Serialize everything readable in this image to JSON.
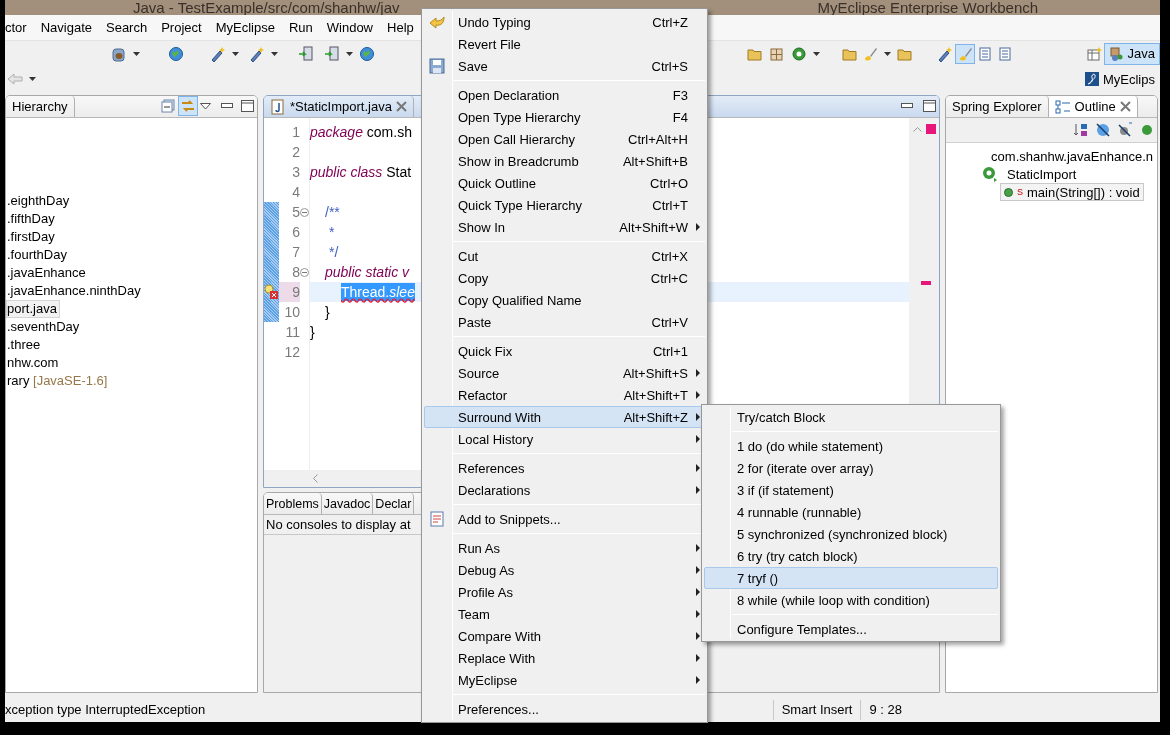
{
  "window": {
    "title_left": "Java - TestExample/src/com/shanhw/jav",
    "title_right": "MyEclipse Enterprise Workbench"
  },
  "menu_bar": [
    "ctor",
    "Navigate",
    "Search",
    "Project",
    "MyEclipse",
    "Run",
    "Window",
    "Help"
  ],
  "perspectives": [
    {
      "label": "Java",
      "selected": true
    },
    {
      "label": "MyEclips",
      "selected": false
    }
  ],
  "left_panel": {
    "tabs": [
      {
        "label": "Hierarchy",
        "selected": false
      }
    ],
    "items": [
      {
        "label": ".eighthDay",
        "selected": false
      },
      {
        "label": ".fifthDay",
        "selected": false
      },
      {
        "label": ".firstDay",
        "selected": false
      },
      {
        "label": ".fourthDay",
        "selected": false
      },
      {
        "label": ".javaEnhance",
        "selected": false
      },
      {
        "label": ".javaEnhance.ninthDay",
        "selected": false
      },
      {
        "label": "port.java",
        "selected": true
      },
      {
        "label": ".seventhDay",
        "selected": false
      },
      {
        "label": ".three",
        "selected": false
      },
      {
        "label": "nhw.com",
        "selected": false
      },
      {
        "label": "rary",
        "suffix": "[JavaSE-1.6]",
        "selected": false
      }
    ]
  },
  "editor": {
    "tab": {
      "label": "*StaticImport.java",
      "selected": true
    },
    "lines": [
      {
        "number": "1",
        "kind": "top",
        "changed": false,
        "current": false,
        "tokens": [
          {
            "text": "package",
            "kind": "keyword"
          },
          {
            "text": "com.sh",
            "kind": "plain"
          }
        ]
      },
      {
        "number": "2",
        "kind": "top",
        "changed": false,
        "current": false
      },
      {
        "number": "3",
        "kind": "top",
        "changed": false,
        "current": false,
        "tokens": [
          {
            "text": "public class",
            "kind": "keyword"
          },
          {
            "text": "Stat",
            "kind": "plain"
          }
        ]
      },
      {
        "number": "4",
        "kind": "top",
        "changed": false,
        "current": false
      },
      {
        "number": "5",
        "kind": "member",
        "collapsible": true,
        "changed": true,
        "current": false,
        "tokens": [
          {
            "text": "/**",
            "kind": "comment"
          }
        ]
      },
      {
        "number": "6",
        "kind": "doc",
        "changed": true,
        "current": false,
        "tokens": [
          {
            "text": "*",
            "kind": "comment"
          }
        ]
      },
      {
        "number": "7",
        "kind": "doc",
        "changed": true,
        "current": false,
        "tokens": [
          {
            "text": "*/",
            "kind": "comment"
          }
        ]
      },
      {
        "number": "8",
        "kind": "member",
        "collapsible": true,
        "changed": true,
        "current": false,
        "tokens": [
          {
            "text": "public static v",
            "kind": "keyword"
          }
        ]
      },
      {
        "number": "9",
        "kind": "body",
        "changed": true,
        "current": true,
        "error": true,
        "tokens": [
          {
            "text": "Thread.",
            "kind": "selected"
          },
          {
            "text": "slee",
            "kind": "selected_static"
          }
        ]
      },
      {
        "number": "10",
        "kind": "member",
        "changed": true,
        "current": false,
        "tokens": [
          {
            "text": "}",
            "kind": "plain"
          }
        ]
      },
      {
        "number": "11",
        "kind": "top",
        "changed": false,
        "current": false,
        "tokens": [
          {
            "text": "}",
            "kind": "plain"
          }
        ]
      },
      {
        "number": "12",
        "kind": "top",
        "changed": false,
        "current": false
      }
    ]
  },
  "console": {
    "tabs": [
      {
        "label": "Problems"
      },
      {
        "label": "Javadoc"
      },
      {
        "label": "Declar"
      }
    ],
    "message": "No consoles to display at"
  },
  "outline": {
    "tabs": [
      {
        "label": "Spring Explorer",
        "selected": false
      },
      {
        "label": "Outline",
        "selected": true
      }
    ],
    "tree": [
      {
        "label": "com.shanhw.javaEnhance.n",
        "kind": "package",
        "selected": false
      },
      {
        "label": "StaticImport",
        "kind": "class",
        "selected": false,
        "children": [
          {
            "label": "main(String[]) : void",
            "kind": "method",
            "badge": "S",
            "selected": true
          }
        ]
      }
    ]
  },
  "context_menu": [
    {
      "kind": "item",
      "label": "Undo Typing",
      "shortcut": "Ctrl+Z",
      "submenu": false,
      "selected": false
    },
    {
      "kind": "item",
      "label": "Revert File",
      "submenu": false,
      "selected": false
    },
    {
      "kind": "item",
      "label": "Save",
      "shortcut": "Ctrl+S",
      "submenu": false,
      "selected": false
    },
    {
      "kind": "separator"
    },
    {
      "kind": "item",
      "label": "Open Declaration",
      "shortcut": "F3",
      "submenu": false,
      "selected": false
    },
    {
      "kind": "item",
      "label": "Open Type Hierarchy",
      "shortcut": "F4",
      "submenu": false,
      "selected": false
    },
    {
      "kind": "item",
      "label": "Open Call Hierarchy",
      "shortcut": "Ctrl+Alt+H",
      "submenu": false,
      "selected": false
    },
    {
      "kind": "item",
      "label": "Show in Breadcrumb",
      "shortcut": "Alt+Shift+B",
      "submenu": false,
      "selected": false
    },
    {
      "kind": "item",
      "label": "Quick Outline",
      "shortcut": "Ctrl+O",
      "submenu": false,
      "selected": false
    },
    {
      "kind": "item",
      "label": "Quick Type Hierarchy",
      "shortcut": "Ctrl+T",
      "submenu": false,
      "selected": false
    },
    {
      "kind": "item",
      "label": "Show In",
      "shortcut": "Alt+Shift+W",
      "submenu": true,
      "selected": false
    },
    {
      "kind": "separator"
    },
    {
      "kind": "item",
      "label": "Cut",
      "shortcut": "Ctrl+X",
      "submenu": false,
      "selected": false
    },
    {
      "kind": "item",
      "label": "Copy",
      "shortcut": "Ctrl+C",
      "submenu": false,
      "selected": false
    },
    {
      "kind": "item",
      "label": "Copy Qualified Name",
      "submenu": false,
      "selected": false
    },
    {
      "kind": "item",
      "label": "Paste",
      "shortcut": "Ctrl+V",
      "submenu": false,
      "selected": false
    },
    {
      "kind": "separator"
    },
    {
      "kind": "item",
      "label": "Quick Fix",
      "shortcut": "Ctrl+1",
      "submenu": false,
      "selected": false
    },
    {
      "kind": "item",
      "label": "Source",
      "shortcut": "Alt+Shift+S",
      "submenu": true,
      "selected": false
    },
    {
      "kind": "item",
      "label": "Refactor",
      "shortcut": "Alt+Shift+T",
      "submenu": true,
      "selected": false
    },
    {
      "kind": "item",
      "label": "Surround With",
      "shortcut": "Alt+Shift+Z",
      "submenu": true,
      "selected": true
    },
    {
      "kind": "item",
      "label": "Local History",
      "submenu": true,
      "selected": false
    },
    {
      "kind": "separator"
    },
    {
      "kind": "item",
      "label": "References",
      "submenu": true,
      "selected": false
    },
    {
      "kind": "item",
      "label": "Declarations",
      "submenu": true,
      "selected": false
    },
    {
      "kind": "separator"
    },
    {
      "kind": "item",
      "label": "Add to Snippets...",
      "submenu": false,
      "selected": false
    },
    {
      "kind": "separator"
    },
    {
      "kind": "item",
      "label": "Run As",
      "submenu": true,
      "selected": false
    },
    {
      "kind": "item",
      "label": "Debug As",
      "submenu": true,
      "selected": false
    },
    {
      "kind": "item",
      "label": "Profile As",
      "submenu": true,
      "selected": false
    },
    {
      "kind": "item",
      "label": "Team",
      "submenu": true,
      "selected": false
    },
    {
      "kind": "item",
      "label": "Compare With",
      "submenu": true,
      "selected": false
    },
    {
      "kind": "item",
      "label": "Replace With",
      "submenu": true,
      "selected": false
    },
    {
      "kind": "item",
      "label": "MyEclipse",
      "submenu": true,
      "selected": false
    },
    {
      "kind": "separator"
    },
    {
      "kind": "item",
      "label": "Preferences...",
      "submenu": false,
      "selected": false
    }
  ],
  "submenu": [
    {
      "kind": "item",
      "label": "Try/catch Block",
      "selected": false
    },
    {
      "kind": "separator"
    },
    {
      "kind": "item",
      "label": "1 do (do while statement)",
      "selected": false
    },
    {
      "kind": "item",
      "label": "2 for (iterate over array)",
      "selected": false
    },
    {
      "kind": "item",
      "label": "3 if (if statement)",
      "selected": false
    },
    {
      "kind": "item",
      "label": "4 runnable (runnable)",
      "selected": false
    },
    {
      "kind": "item",
      "label": "5 synchronized (synchronized block)",
      "selected": false
    },
    {
      "kind": "item",
      "label": "6 try (try catch block)",
      "selected": false
    },
    {
      "kind": "item",
      "label": "7 tryf ()",
      "selected": true
    },
    {
      "kind": "item",
      "label": "8 while (while loop with condition)",
      "selected": false
    },
    {
      "kind": "separator"
    },
    {
      "kind": "item",
      "label": "Configure Templates...",
      "selected": false
    }
  ],
  "status_bar": {
    "message": "xception type InterruptedException",
    "insert_mode": "Smart Insert",
    "position": "9 : 28"
  }
}
